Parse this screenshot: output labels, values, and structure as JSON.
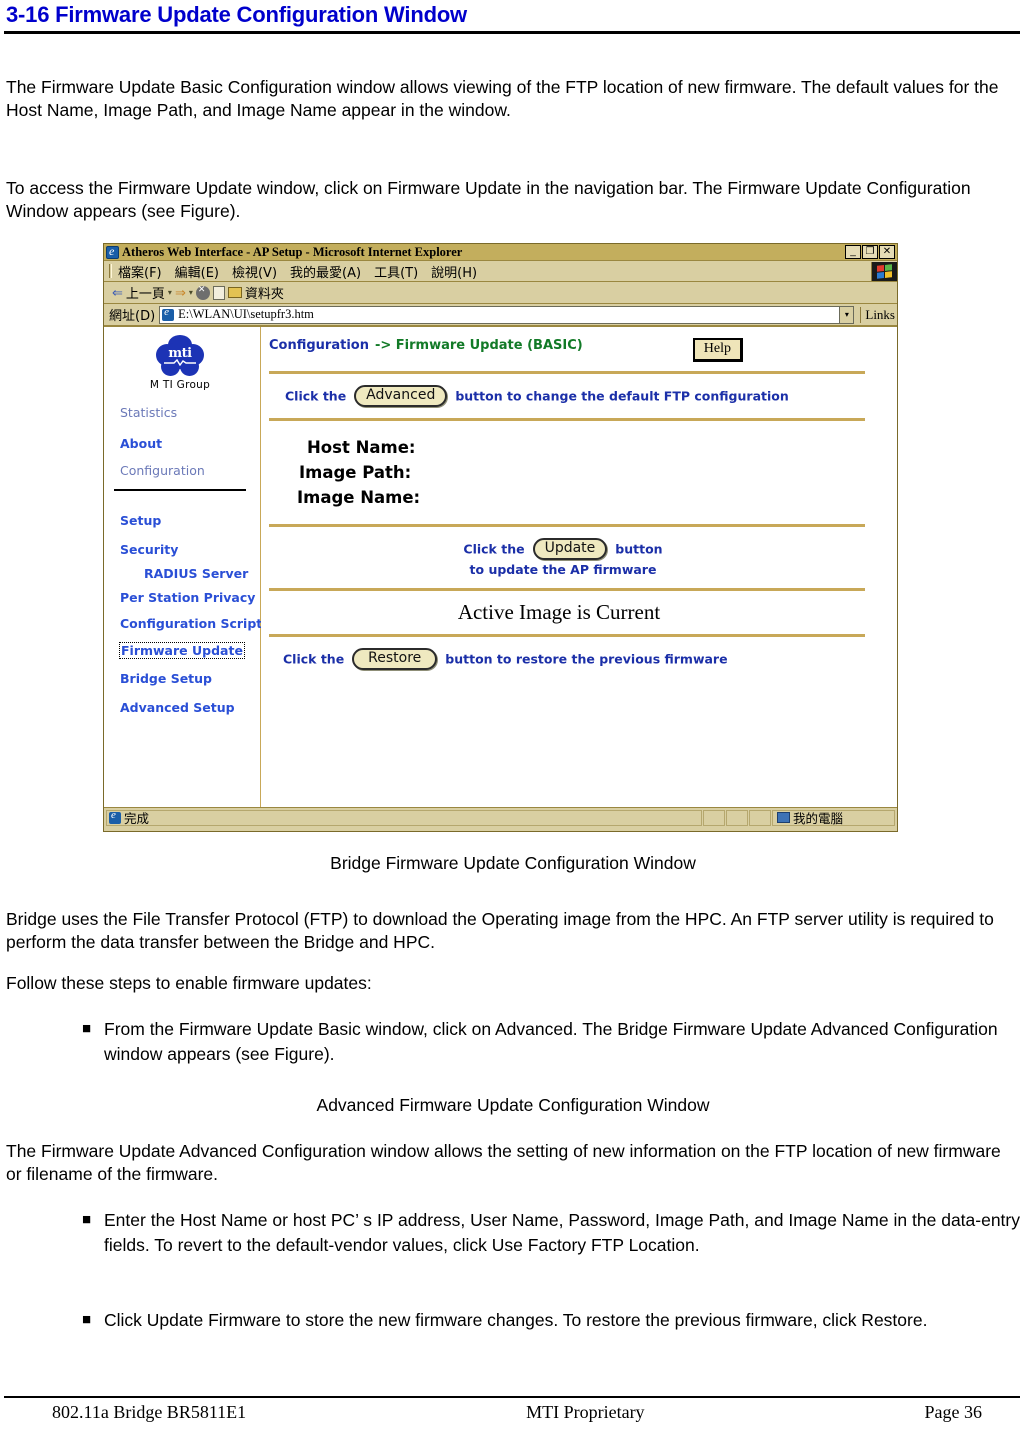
{
  "heading": "3-16 Firmware Update Configuration Window",
  "paragraphs": {
    "p1": "The Firmware Update Basic Configuration window allows viewing of the FTP location of new firmware. The default values for the Host Name, Image Path, and Image Name appear in the window.",
    "p2": "To access the Firmware Update window, click on Firmware Update in the navigation bar. The Firmware Update Configuration Window appears (see Figure).",
    "fig_caption_1": "Bridge Firmware Update Configuration Window",
    "p3": "Bridge uses the File Transfer Protocol (FTP) to download the Operating image from the HPC. An FTP server utility is required to perform the data transfer between the Bridge and HPC.",
    "p4": "Follow these steps to enable firmware updates:",
    "bullet1": "From the Firmware Update Basic window, click on Advanced. The Bridge Firmware Update Advanced Configuration window appears (see Figure).",
    "fig_caption_2": "Advanced Firmware Update Configuration Window",
    "p5": "The Firmware Update Advanced Configuration window allows the setting of new information on the FTP location of new firmware or filename of the firmware.",
    "bullet2": "Enter the Host Name or host PC’ s IP address, User Name, Password, Image Path, and Image Name in the data-entry fields. To revert to the default-vendor values, click Use Factory FTP Location.",
    "bullet3": "Click Update Firmware to store the new firmware changes. To restore the previous firmware, click Restore.",
    "bullet_mark": "■"
  },
  "footer": {
    "left": "802.11a Bridge BR5811E1",
    "center": "MTI Proprietary",
    "right": "Page 36"
  },
  "browser": {
    "title": "Atheros Web Interface - AP Setup - Microsoft Internet Explorer",
    "window_buttons": {
      "minimize": "_",
      "restore": "❐",
      "close": "✕"
    },
    "menu_items": [
      "檔案(F)",
      "編輯(E)",
      "檢視(V)",
      "我的最愛(A)",
      "工具(T)",
      "說明(H)"
    ],
    "toolbar": {
      "back_arrow": "⇐",
      "back_label": "上一頁",
      "caret": "▾",
      "forward_arrow": "⇒",
      "folders_label": "資料夾"
    },
    "address": {
      "label": "網址(D)",
      "url": "E:\\WLAN\\UI\\setupfr3.htm",
      "dropdown": "▾",
      "links_label": "Links"
    },
    "status": {
      "text": "完成",
      "zone": "我的電腦"
    }
  },
  "ap_page": {
    "logo": {
      "word": "mti",
      "name": "M TI Group"
    },
    "nav": [
      {
        "label": "Statistics",
        "style": "dim"
      },
      {
        "label": "About",
        "style": "bold"
      },
      {
        "label": "Configuration",
        "style": "dim"
      },
      {
        "label": "Setup",
        "style": "bold"
      },
      {
        "label": "Security",
        "style": "bold"
      },
      {
        "label": "RADIUS Server",
        "style": "indent"
      },
      {
        "label": "Per Station Privacy",
        "style": "bold"
      },
      {
        "label": "Configuration Script",
        "style": "bold"
      },
      {
        "label": "Firmware Update",
        "style": "focused"
      },
      {
        "label": "Bridge Setup",
        "style": "bold"
      },
      {
        "label": "Advanced Setup",
        "style": "bold"
      }
    ],
    "breadcrumb_blue": "Configuration",
    "breadcrumb_green": "-> Firmware Update (BASIC)",
    "help_button": "Help",
    "advanced_row": {
      "pre": "Click the",
      "button": "Advanced",
      "post": "button to change the default FTP configuration"
    },
    "fields": {
      "host_name": "Host Name:",
      "image_path": "Image Path:",
      "image_name": "Image Name:"
    },
    "update_row": {
      "pre": "Click the",
      "button": "Update",
      "post": "button",
      "line2": "to update the AP firmware"
    },
    "active_image": "Active Image is Current",
    "restore_row": {
      "pre": "Click the",
      "button": "Restore",
      "post": "button to restore the previous firmware"
    }
  },
  "colors": {
    "heading_blue": "#0000cc",
    "nav_blue": "#2a4fd6",
    "breadcrumb_green": "#127a27",
    "divider_gold": "#c8a858",
    "chrome_tan": "#d9cfa2"
  }
}
